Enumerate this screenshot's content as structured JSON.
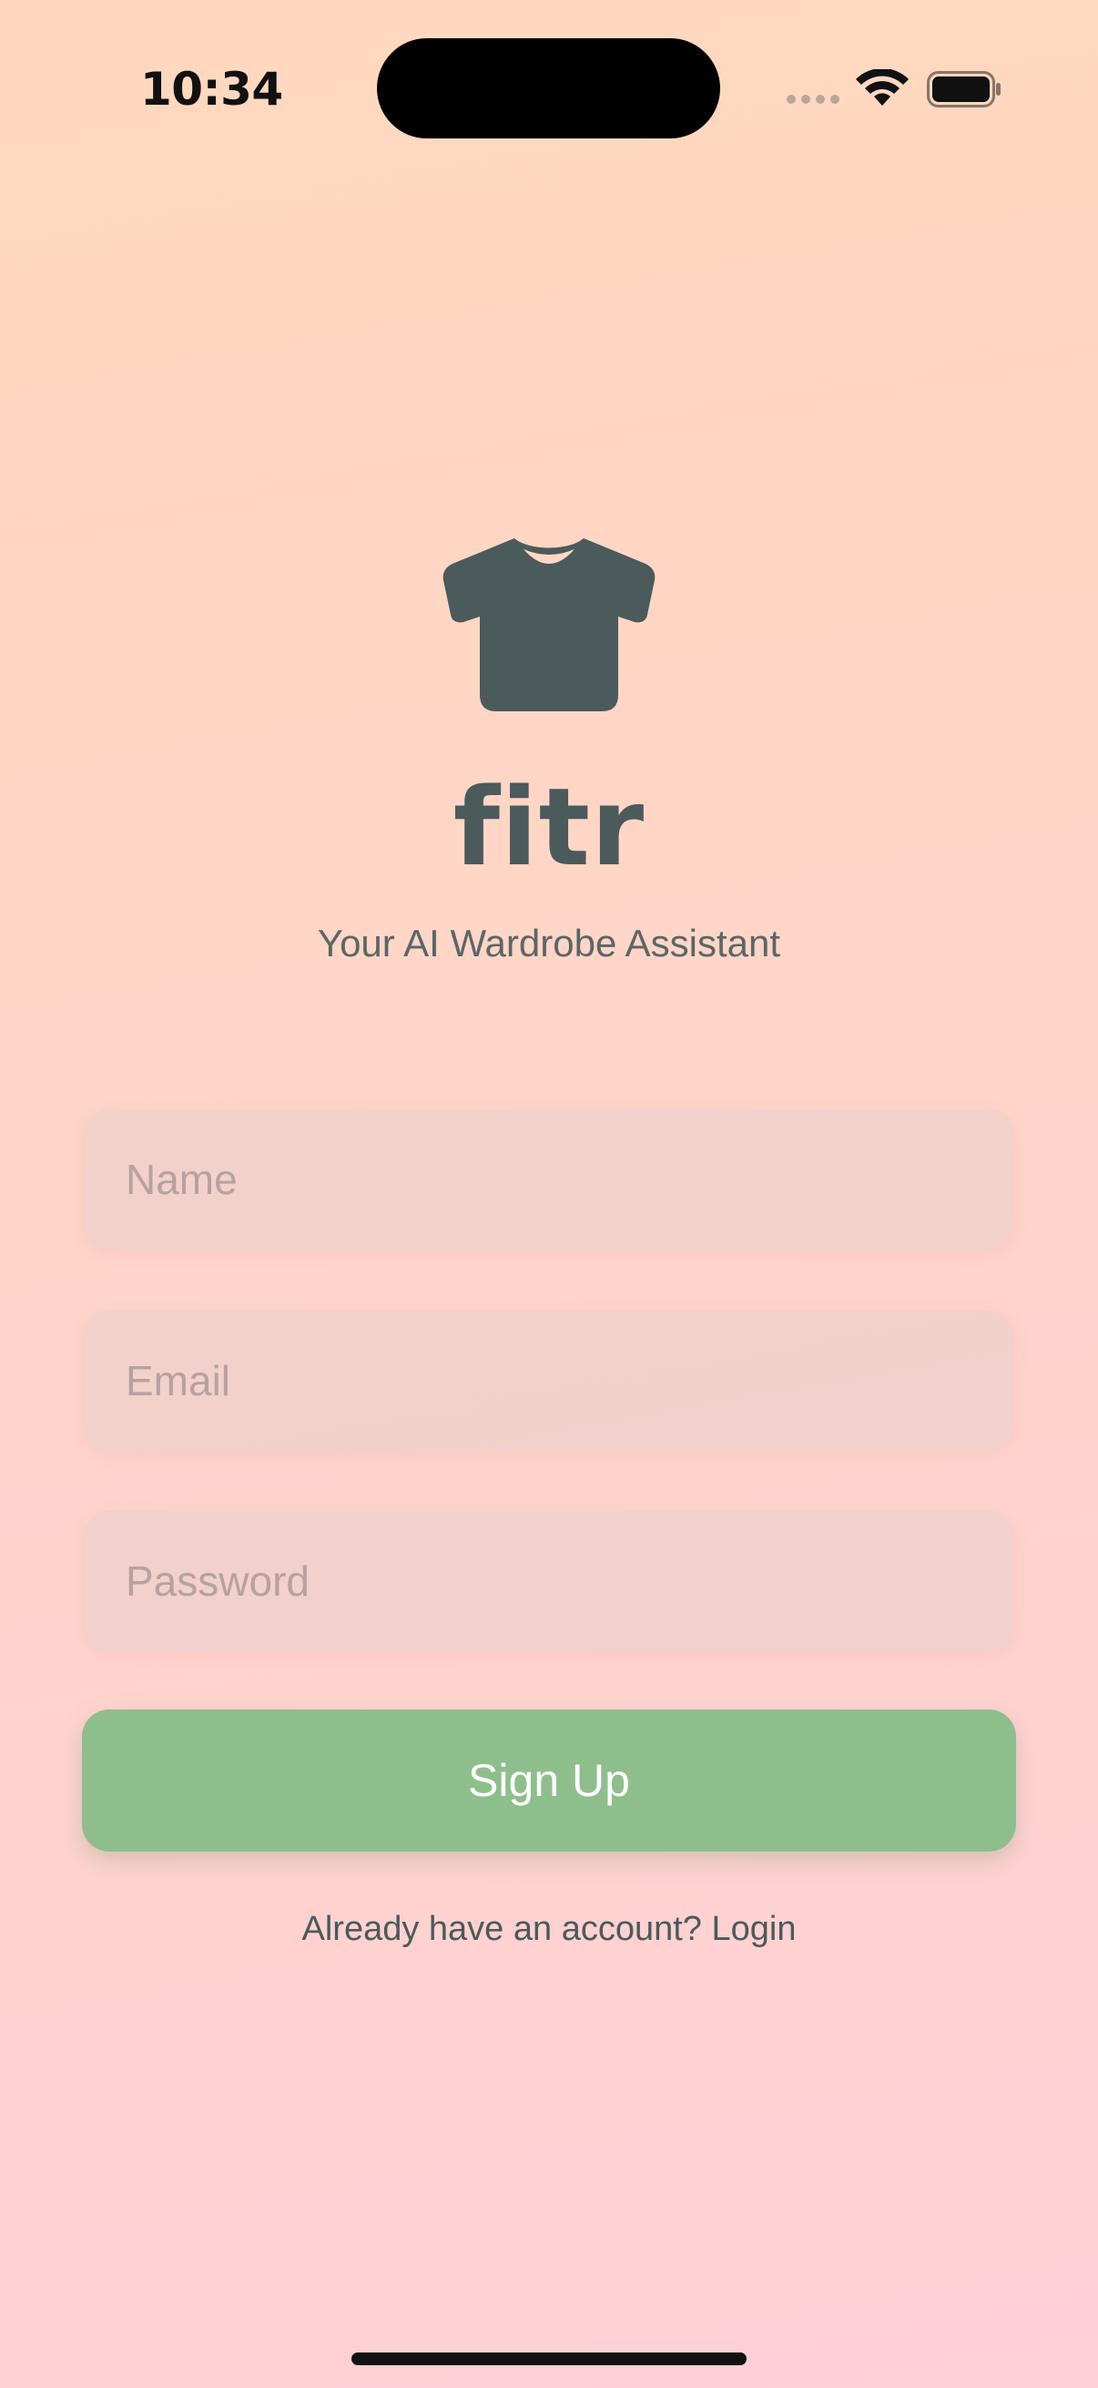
{
  "status_bar": {
    "time": "10:34",
    "signal_icon": "cellular-signal-icon",
    "wifi_icon": "wifi-icon",
    "battery_icon": "battery-icon"
  },
  "logo": {
    "icon": "tshirt-icon",
    "title": "fitr",
    "tagline": "Your AI Wardrobe Assistant"
  },
  "form": {
    "name_placeholder": "Name",
    "name_value": "",
    "email_placeholder": "Email",
    "email_value": "",
    "password_placeholder": "Password",
    "password_value": "",
    "signup_label": "Sign Up",
    "login_prompt": "Already have an account? Login"
  },
  "colors": {
    "accent_green": "#8FBE8D",
    "logo_slate": "#4B5A5B",
    "background_top": "#FFD8BE",
    "background_bottom": "#FFCFD6"
  }
}
